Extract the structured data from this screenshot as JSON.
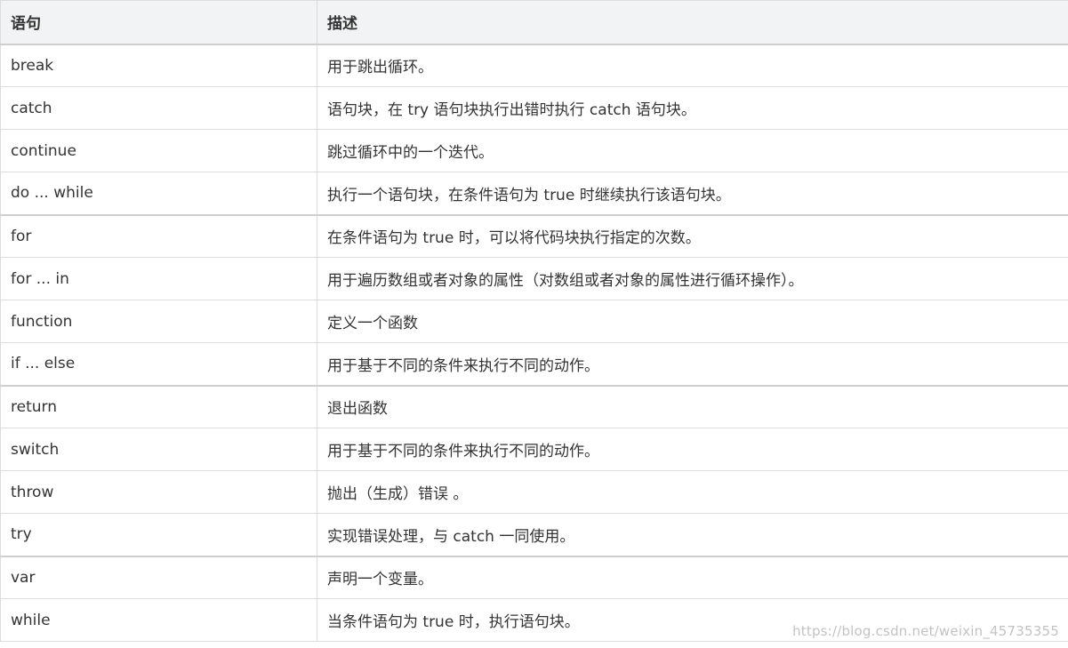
{
  "table": {
    "headers": {
      "statement": "语句",
      "description": "描述"
    },
    "rows": [
      {
        "statement": "break",
        "description": "用于跳出循环。"
      },
      {
        "statement": "catch",
        "description": "语句块，在 try 语句块执行出错时执行 catch 语句块。"
      },
      {
        "statement": "continue",
        "description": "跳过循环中的一个迭代。"
      },
      {
        "statement": "do ... while",
        "description": "执行一个语句块，在条件语句为 true 时继续执行该语句块。"
      },
      {
        "statement": "for",
        "description": "在条件语句为 true 时，可以将代码块执行指定的次数。"
      },
      {
        "statement": "for ... in",
        "description": "用于遍历数组或者对象的属性（对数组或者对象的属性进行循环操作）。"
      },
      {
        "statement": "function",
        "description": "定义一个函数"
      },
      {
        "statement": "if ... else",
        "description": "用于基于不同的条件来执行不同的动作。"
      },
      {
        "statement": "return",
        "description": "退出函数"
      },
      {
        "statement": "switch",
        "description": "用于基于不同的条件来执行不同的动作。"
      },
      {
        "statement": "throw",
        "description": "抛出（生成）错误 。"
      },
      {
        "statement": "try",
        "description": "实现错误处理，与 catch 一同使用。"
      },
      {
        "statement": "var",
        "description": "声明一个变量。"
      },
      {
        "statement": "while",
        "description": "当条件语句为 true 时，执行语句块。"
      }
    ]
  },
  "watermark": "https://blog.csdn.net/weixin_45735355"
}
